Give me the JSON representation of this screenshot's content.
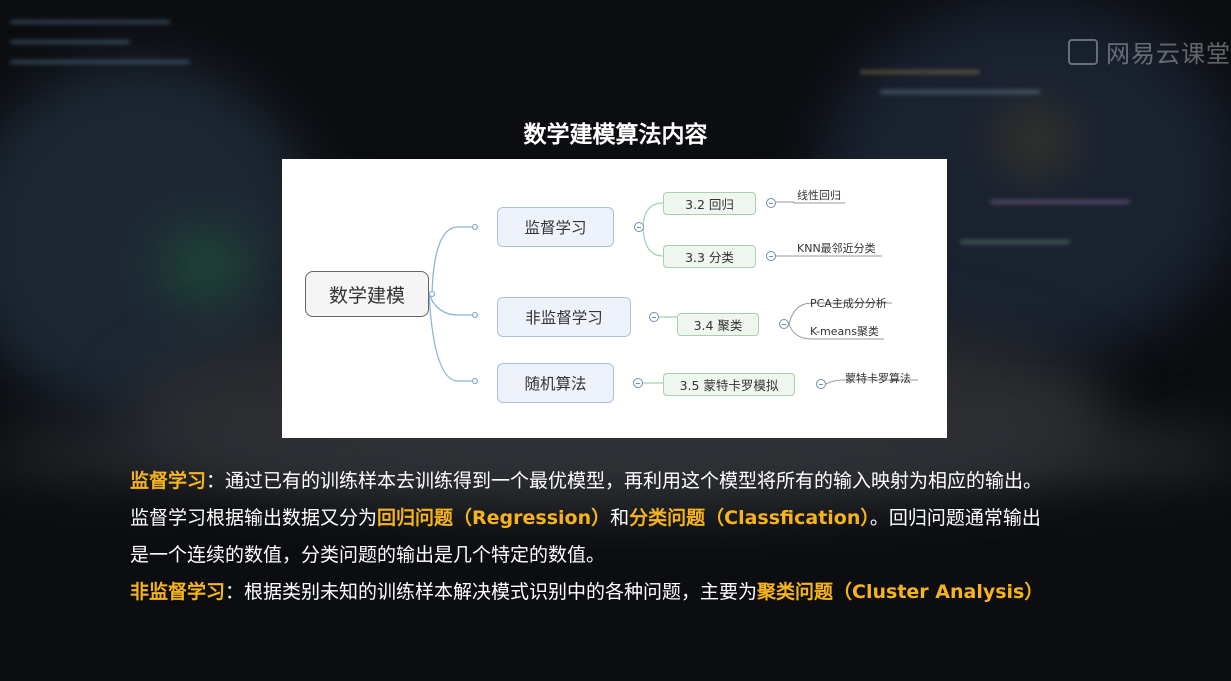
{
  "logo": {
    "text": "网易云课堂"
  },
  "title": "数学建模算法内容",
  "mindmap": {
    "root": "数学建模",
    "branches": [
      {
        "label": "监督学习"
      },
      {
        "label": "非监督学习"
      },
      {
        "label": "随机算法"
      }
    ],
    "subnodes": {
      "regression": "3.2  回归",
      "classification": "3.3  分类",
      "clustering": "3.4 聚类",
      "montecarlo": "3.5 蒙特卡罗模拟"
    },
    "leaves": {
      "linear_regression": "线性回归",
      "knn": "KNN最邻近分类",
      "pca": "PCA主成分分析",
      "kmeans": "K-means聚类",
      "montecarlo_algo": "蒙特卡罗算法"
    }
  },
  "text": {
    "p1_term": "监督学习",
    "p1_body": "：通过已有的训练样本去训练得到一个最优模型，再利用这个模型将所有的输入映射为相应的输出。",
    "p2_a": "监督学习根据输出数据又分为",
    "p2_hl1": "回归问题（Regression）",
    "p2_b": "和",
    "p2_hl2": "分类问题（Classfication）",
    "p2_c": "。回归问题通常输出",
    "p3": "是一个连续的数值，分类问题的输出是几个特定的数值。",
    "p4_term": "非监督学习",
    "p4_body": "：根据类别未知的训练样本解决模式识别中的各种问题，主要为",
    "p4_hl": "聚类问题（Cluster Analysis）"
  }
}
